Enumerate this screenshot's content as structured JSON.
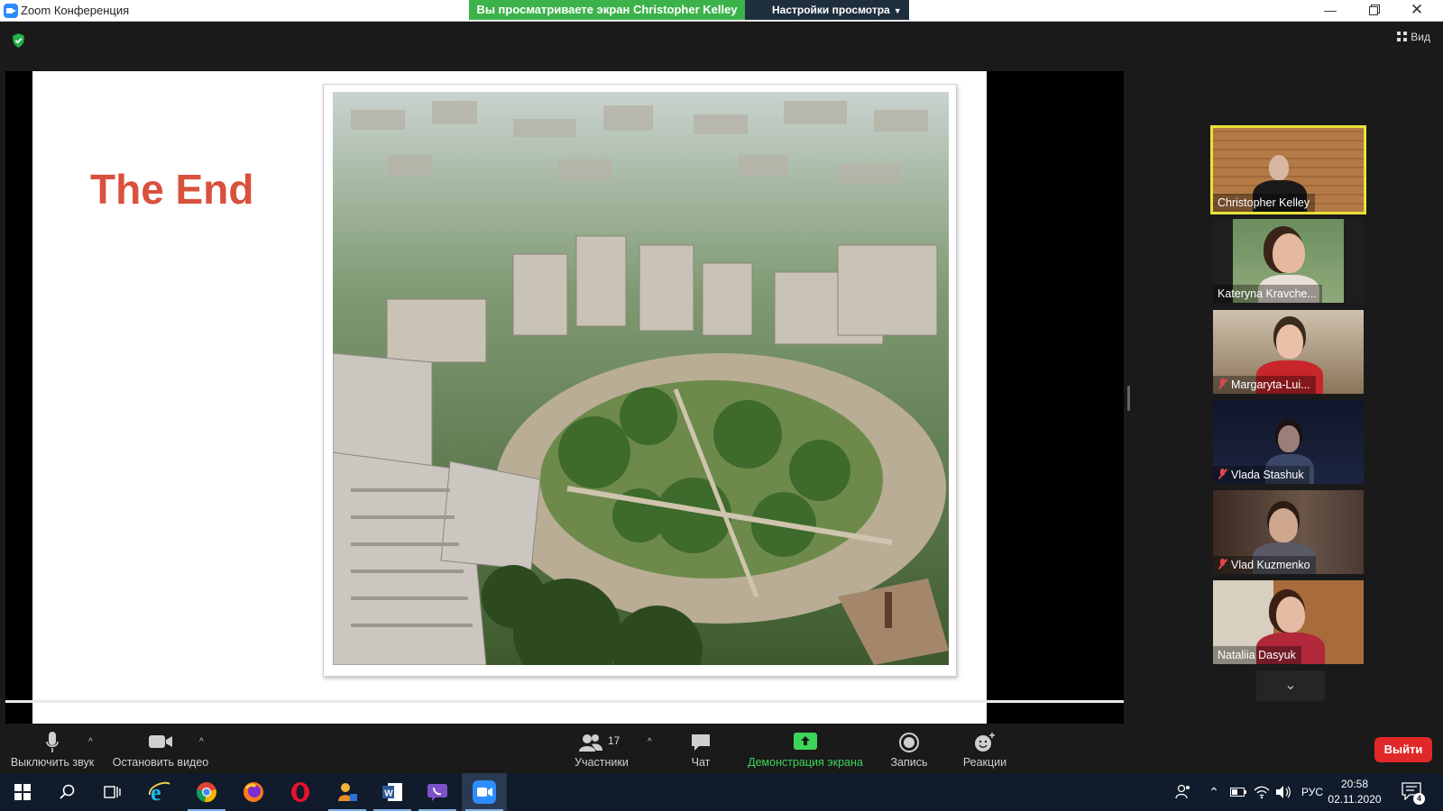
{
  "window": {
    "title": "Zoom Конференция",
    "share_banner": "Вы просматриваете экран Christopher Kelley",
    "view_options": "Настройки просмотра",
    "view_button": "Вид"
  },
  "slide": {
    "title": "The End"
  },
  "participants": [
    {
      "name": "Christopher Kelley",
      "muted": false,
      "active": true
    },
    {
      "name": "Kateryna Kravche...",
      "muted": false,
      "active": false
    },
    {
      "name": "Margaryta-Lui...",
      "muted": true,
      "active": false
    },
    {
      "name": "Vlada Stashuk",
      "muted": true,
      "active": false
    },
    {
      "name": "Vlad Kuzmenko",
      "muted": true,
      "active": false
    },
    {
      "name": "Nataliia Dasyuk",
      "muted": false,
      "active": false
    }
  ],
  "controls": {
    "mute": "Выключить звук",
    "stop_video": "Остановить видео",
    "participants": "Участники",
    "participants_count": "17",
    "chat": "Чат",
    "share_screen": "Демонстрация экрана",
    "record": "Запись",
    "reactions": "Реакции",
    "leave": "Выйти"
  },
  "taskbar": {
    "language": "РУС",
    "time": "20:58",
    "date": "02.11.2020",
    "notifications": "4",
    "apps": [
      "start-icon",
      "search-icon",
      "task-view-icon",
      "internet-explorer-icon",
      "chrome-icon",
      "firefox-icon",
      "opera-icon",
      "user-app-icon",
      "word-icon",
      "viber-icon",
      "zoom-icon"
    ]
  },
  "colors": {
    "accent_green": "#3cb24a",
    "slide_title_red": "#d9503d",
    "leave_red": "#e02828",
    "active_speaker": "#e8e23a"
  }
}
